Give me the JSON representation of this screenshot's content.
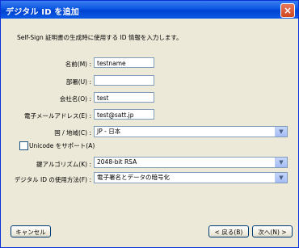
{
  "window": {
    "title": "デジタル ID を追加",
    "close_glyph": "×"
  },
  "instruction": "Self-Sign 証明書の生成時に使用する ID 情報を入力します。",
  "fields": {
    "name": {
      "label": "名前(M) :",
      "value": "testname"
    },
    "department": {
      "label": "部署(U) :",
      "value": ""
    },
    "company": {
      "label": "会社名(O) :",
      "value": "test"
    },
    "email": {
      "label": "電子メールアドレス(E) :",
      "value": "test@satt.jp"
    }
  },
  "region": {
    "label": "国 / 地域(C) :",
    "selected": "JP - 日本"
  },
  "unicode_support": {
    "label": "Unicode をサポート(A)",
    "checked": false
  },
  "key_algorithm": {
    "label": "鍵アルゴリズム(K) :",
    "selected": "2048-bit RSA"
  },
  "id_usage": {
    "label": "デジタル ID の使用方法(F) :",
    "selected": "電子署名とデータの暗号化"
  },
  "buttons": {
    "cancel": "キャンセル",
    "back": "< 戻る(B)",
    "next": "次へ(N) >"
  },
  "icons": {
    "dropdown": "chevron-down-icon",
    "close": "close-icon"
  },
  "colors": {
    "titlebar": "#0a57e3",
    "close_button": "#d0451f",
    "dialog_bg": "#ece9d8"
  }
}
